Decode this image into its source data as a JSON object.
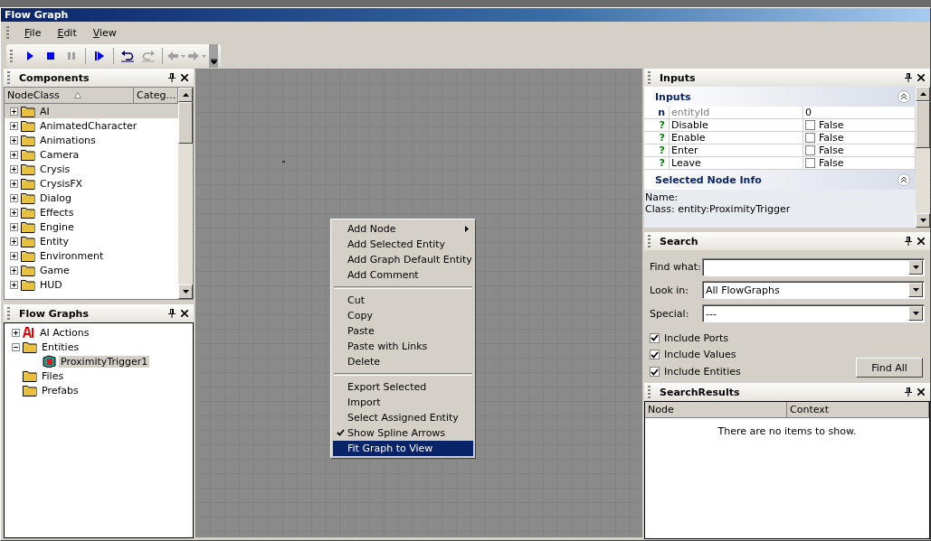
{
  "window": {
    "title": "Flow Graph"
  },
  "menu": [
    "File",
    "Edit",
    "View"
  ],
  "toolbar": [
    {
      "kind": "play",
      "disabled": false
    },
    {
      "kind": "stop",
      "disabled": false
    },
    {
      "kind": "pause",
      "disabled": true
    },
    {
      "kind": "sep"
    },
    {
      "kind": "step",
      "disabled": false
    },
    {
      "kind": "sep"
    },
    {
      "kind": "undo",
      "disabled": false
    },
    {
      "kind": "redo",
      "disabled": true
    },
    {
      "kind": "sep"
    },
    {
      "kind": "back",
      "disabled": true
    },
    {
      "kind": "forward",
      "disabled": true
    }
  ],
  "components": {
    "title": "Components",
    "columns": [
      "NodeClass",
      "Categ…"
    ],
    "items": [
      {
        "label": "AI",
        "selected": true
      },
      {
        "label": "AnimatedCharacter",
        "selected": false
      },
      {
        "label": "Animations",
        "selected": false
      },
      {
        "label": "Camera",
        "selected": false
      },
      {
        "label": "Crysis",
        "selected": false
      },
      {
        "label": "CrysisFX",
        "selected": false
      },
      {
        "label": "Dialog",
        "selected": false
      },
      {
        "label": "Effects",
        "selected": false
      },
      {
        "label": "Engine",
        "selected": false
      },
      {
        "label": "Entity",
        "selected": false
      },
      {
        "label": "Environment",
        "selected": false
      },
      {
        "label": "Game",
        "selected": false
      },
      {
        "label": "HUD",
        "selected": false
      }
    ]
  },
  "flow_graphs": {
    "title": "Flow Graphs",
    "tree": [
      {
        "label": "AI Actions",
        "kind": "ai",
        "expanded": false,
        "selected": false
      },
      {
        "label": "Entities",
        "kind": "folder",
        "expanded": true,
        "selected": false,
        "children": [
          {
            "label": "ProximityTrigger1",
            "kind": "entity",
            "selected": true
          }
        ]
      },
      {
        "label": "Files",
        "kind": "folder",
        "selected": false
      },
      {
        "label": "Prefabs",
        "kind": "folder",
        "selected": false
      }
    ]
  },
  "context_menu": [
    {
      "kind": "item",
      "label": "Add Node",
      "submenu": true,
      "checked": false,
      "selected": false
    },
    {
      "kind": "item",
      "label": "Add Selected Entity",
      "submenu": false,
      "checked": false,
      "selected": false
    },
    {
      "kind": "item",
      "label": "Add Graph Default Entity",
      "submenu": false,
      "checked": false,
      "selected": false
    },
    {
      "kind": "item",
      "label": "Add Comment",
      "submenu": false,
      "checked": false,
      "selected": false
    },
    {
      "kind": "separator"
    },
    {
      "kind": "item",
      "label": "Cut",
      "submenu": false,
      "checked": false,
      "selected": false
    },
    {
      "kind": "item",
      "label": "Copy",
      "submenu": false,
      "checked": false,
      "selected": false
    },
    {
      "kind": "item",
      "label": "Paste",
      "submenu": false,
      "checked": false,
      "selected": false
    },
    {
      "kind": "item",
      "label": "Paste with Links",
      "submenu": false,
      "checked": false,
      "selected": false
    },
    {
      "kind": "item",
      "label": "Delete",
      "submenu": false,
      "checked": false,
      "selected": false
    },
    {
      "kind": "separator"
    },
    {
      "kind": "item",
      "label": "Export Selected",
      "submenu": false,
      "checked": false,
      "selected": false
    },
    {
      "kind": "item",
      "label": "Import",
      "submenu": false,
      "checked": false,
      "selected": false
    },
    {
      "kind": "item",
      "label": "Select Assigned Entity",
      "submenu": false,
      "checked": false,
      "selected": false
    },
    {
      "kind": "item",
      "label": "Show Spline Arrows",
      "submenu": false,
      "checked": true,
      "selected": false
    },
    {
      "kind": "item",
      "label": "Fit Graph to View",
      "submenu": false,
      "checked": false,
      "selected": true
    }
  ],
  "inputs": {
    "title": "Inputs",
    "section_title": "Inputs",
    "ports": [
      {
        "kind": "number",
        "type": "n",
        "name": "entityId",
        "value": "0",
        "disabled": true
      },
      {
        "kind": "bool",
        "type": "?",
        "name": "Disable",
        "value": "False",
        "checked": false,
        "disabled": false
      },
      {
        "kind": "bool",
        "type": "?",
        "name": "Enable",
        "value": "False",
        "checked": false,
        "disabled": false
      },
      {
        "kind": "bool",
        "type": "?",
        "name": "Enter",
        "value": "False",
        "checked": false,
        "disabled": false
      },
      {
        "kind": "bool",
        "type": "?",
        "name": "Leave",
        "value": "False",
        "checked": false,
        "disabled": false
      }
    ],
    "info_title": "Selected Node Info",
    "info_lines": [
      "Name:",
      "Class: entity:ProximityTrigger"
    ]
  },
  "search": {
    "title": "Search",
    "fields": [
      {
        "label": "Find what:"
      },
      {
        "label": "Look in:",
        "value": "All FlowGraphs"
      },
      {
        "label": "Special:",
        "value": "---"
      }
    ],
    "options": [
      {
        "label": "Include Ports",
        "checked": true
      },
      {
        "label": "Include Values",
        "checked": true
      },
      {
        "label": "Include Entities",
        "checked": true
      }
    ],
    "button": "Find All"
  },
  "search_results": {
    "title": "SearchResults",
    "columns": [
      "Node",
      "Context"
    ],
    "empty_message": "There are no items to show."
  }
}
